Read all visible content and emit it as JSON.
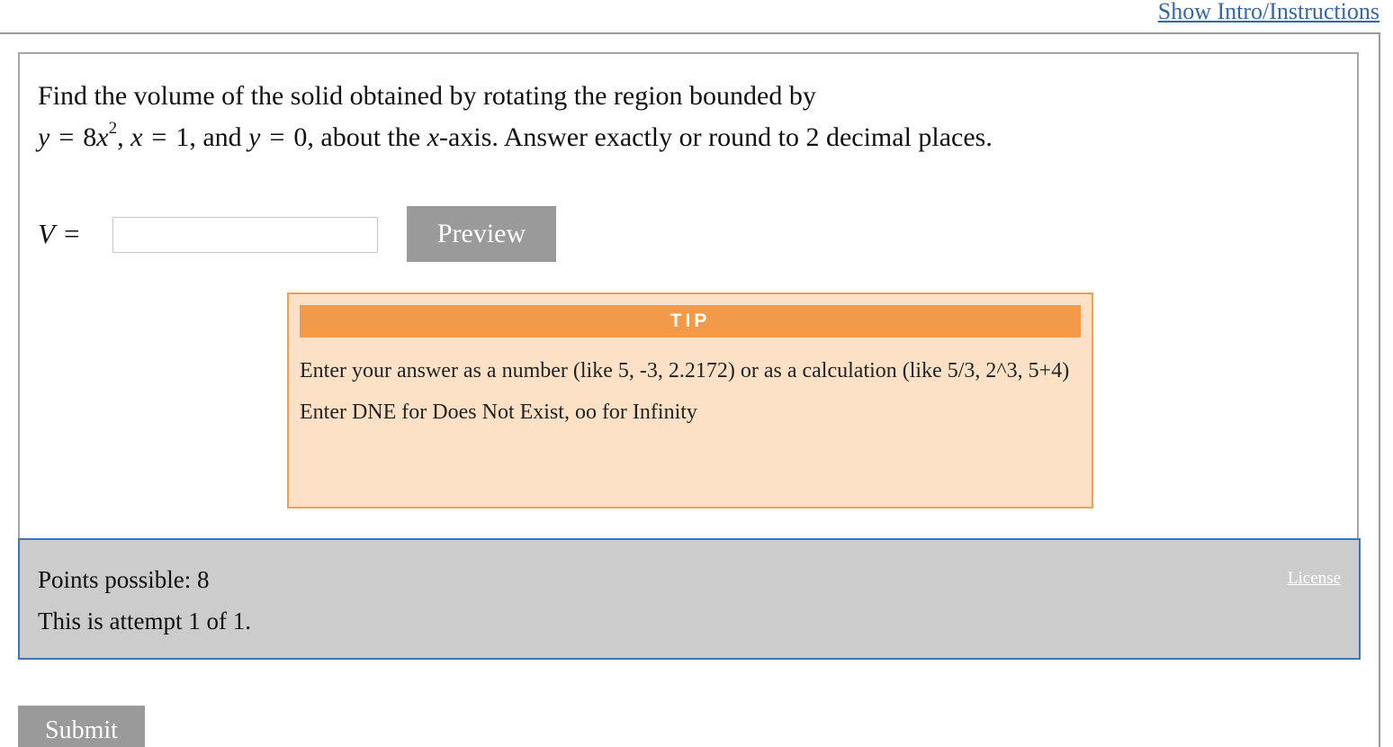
{
  "header": {
    "intro_link": "Show Intro/Instructions"
  },
  "question": {
    "line1": "Find the volume of the solid obtained by rotating the region bounded by",
    "eq_y": "y",
    "eq_equals": "=",
    "eq_coef": "8",
    "eq_x": "x",
    "eq_exp": "2",
    "comma1": ",",
    "cond2_var": "x",
    "cond2_eq": "=",
    "cond2_val": "1, and",
    "cond3_var": "y",
    "cond3_eq": "=",
    "cond3_val": "0, about the",
    "axis_var": "x",
    "line2_rest": "-axis. Answer exactly or round to 2 decimal places."
  },
  "answer": {
    "label_var": "V",
    "label_eq": "=",
    "input_value": "",
    "input_placeholder": "",
    "preview_label": "Preview"
  },
  "tip": {
    "header": "TIP",
    "line1": "Enter your answer as a number (like 5, -3, 2.2172) or as a calculation (like 5/3, 2^3, 5+4)",
    "line2": "Enter DNE for Does Not Exist, oo for Infinity"
  },
  "info": {
    "points": "Points possible: 8",
    "attempt": "This is attempt 1 of 1.",
    "license": "License"
  },
  "footer": {
    "submit_label": "Submit"
  },
  "colors": {
    "link": "#3466a8",
    "button_bg": "#9a9a9a",
    "tip_header": "#f39a4a",
    "tip_bg": "#fce1c6",
    "info_bg": "#cccccc",
    "info_border": "#3e74b8"
  }
}
